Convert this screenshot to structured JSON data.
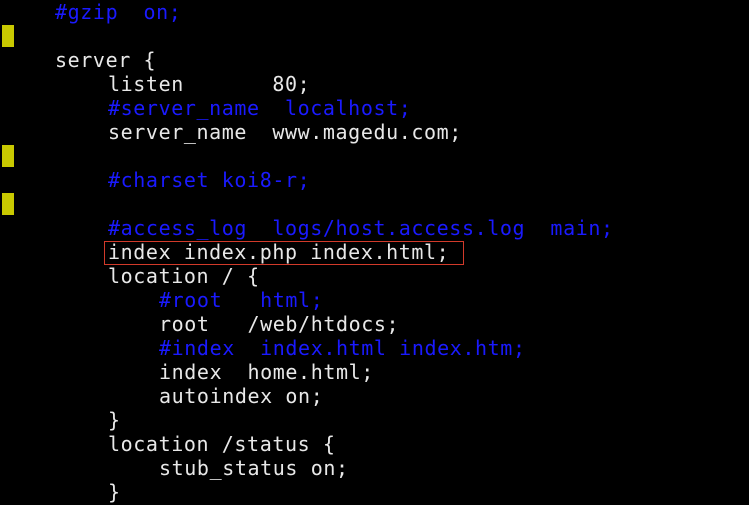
{
  "editor": {
    "lines": [
      {
        "text": "#gzip  on;",
        "comment": true
      },
      {
        "text": "",
        "comment": false
      },
      {
        "text": "server {",
        "comment": false
      },
      {
        "text": "listen       80;",
        "comment": false
      },
      {
        "text": "#server_name  localhost;",
        "comment": true
      },
      {
        "text": "server_name  www.magedu.com;",
        "comment": false
      },
      {
        "text": "",
        "comment": false
      },
      {
        "text": "#charset koi8-r;",
        "comment": true
      },
      {
        "text": "",
        "comment": false
      },
      {
        "text": "#access_log  logs/host.access.log  main;",
        "comment": true
      },
      {
        "text": "index index.php index.html;",
        "comment": false
      },
      {
        "text": "location / {",
        "comment": false
      },
      {
        "text": "#root   html;",
        "comment": true
      },
      {
        "text": "root   /web/htdocs;",
        "comment": false
      },
      {
        "text": "#index  index.html index.htm;",
        "comment": true
      },
      {
        "text": "index  home.html;",
        "comment": false
      },
      {
        "text": "autoindex on;",
        "comment": false
      },
      {
        "text": "}",
        "comment": false
      },
      {
        "text": "location /status {",
        "comment": false
      },
      {
        "text": "stub_status on;",
        "comment": false
      },
      {
        "text": "}",
        "comment": false
      }
    ]
  },
  "colors": {
    "background": "#000000",
    "text": "#e8e8e8",
    "comment": "#1a1aff",
    "marker": "#c9c900",
    "highlight_border": "#d23a2a"
  }
}
